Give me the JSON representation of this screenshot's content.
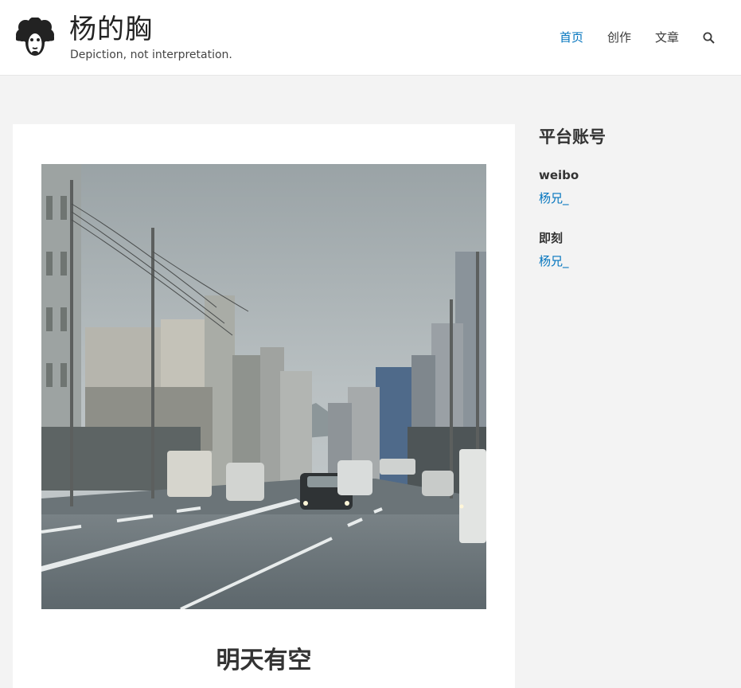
{
  "site": {
    "title": "杨的胸",
    "tagline": "Depiction, not interpretation."
  },
  "nav": {
    "items": [
      {
        "label": "首页",
        "active": true
      },
      {
        "label": "创作",
        "active": false
      },
      {
        "label": "文章",
        "active": false
      }
    ]
  },
  "post": {
    "title": "明天有空"
  },
  "sidebar": {
    "widget_title": "平台账号",
    "accounts": [
      {
        "platform": "weibo",
        "handle": "杨兄_"
      },
      {
        "platform": "即刻",
        "handle": "杨兄_"
      }
    ]
  },
  "colors": {
    "accent": "#0274be",
    "background": "#f3f3f3",
    "card": "#ffffff"
  }
}
